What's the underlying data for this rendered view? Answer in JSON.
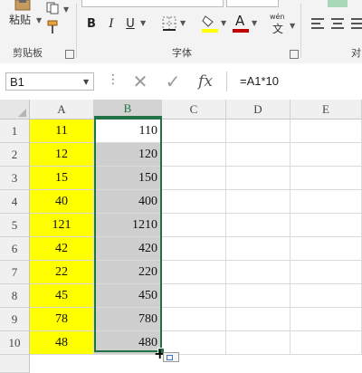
{
  "ribbon": {
    "clipboard": {
      "paste_label": "粘贴",
      "group_label": "剪贴板"
    },
    "font": {
      "group_label": "字体",
      "bold": "B",
      "italic": "I",
      "underline": "U",
      "font_color_letter": "A",
      "phonetic_label": "wén"
    },
    "alignment": {
      "group_label": "对"
    },
    "colors": {
      "fill_color": "#ffff00",
      "font_color": "#c00000"
    }
  },
  "formula_bar": {
    "name_box": "B1",
    "formula": "=A1*10"
  },
  "grid": {
    "columns": [
      "A",
      "B",
      "C",
      "D",
      "E"
    ],
    "selected_column": "B",
    "rows": [
      {
        "num": "1",
        "a": "11",
        "b": "110"
      },
      {
        "num": "2",
        "a": "12",
        "b": "120"
      },
      {
        "num": "3",
        "a": "15",
        "b": "150"
      },
      {
        "num": "4",
        "a": "40",
        "b": "400"
      },
      {
        "num": "5",
        "a": "121",
        "b": "1210"
      },
      {
        "num": "6",
        "a": "42",
        "b": "420"
      },
      {
        "num": "7",
        "a": "22",
        "b": "220"
      },
      {
        "num": "8",
        "a": "45",
        "b": "450"
      },
      {
        "num": "9",
        "a": "78",
        "b": "780"
      },
      {
        "num": "10",
        "a": "48",
        "b": "480"
      }
    ]
  },
  "colors": {
    "highlight_yellow": "#ffff00",
    "selection_green": "#217346",
    "selection_fill": "#cfcfcf"
  }
}
